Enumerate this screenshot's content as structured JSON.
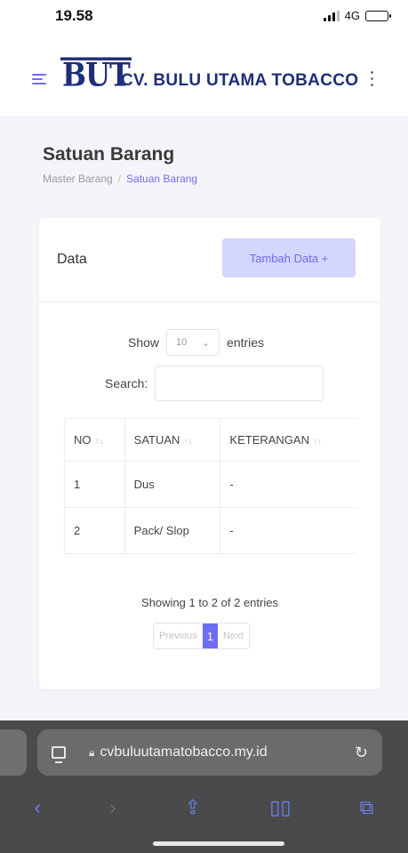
{
  "status_bar": {
    "time": "19.58",
    "network": "4G"
  },
  "header": {
    "logo_text": "BUT",
    "company_name": "CV. BULU UTAMA TOBACCO"
  },
  "page": {
    "title": "Satuan Barang",
    "breadcrumb": {
      "parent": "Master Barang",
      "separator": "/",
      "current": "Satuan Barang"
    }
  },
  "card": {
    "title": "Data",
    "add_button": "Tambah Data +",
    "length_prefix": "Show",
    "length_value": "10",
    "length_suffix": "entries",
    "search_label": "Search:",
    "search_value": "",
    "columns": [
      "NO",
      "SATUAN",
      "KETERANGAN"
    ],
    "sort_glyph": "↑↓",
    "rows": [
      {
        "no": "1",
        "satuan": "Dus",
        "keterangan": "-"
      },
      {
        "no": "2",
        "satuan": "Pack/ Slop",
        "keterangan": "-"
      }
    ],
    "info": "Showing 1 to 2 of 2 entries",
    "pagination": {
      "previous": "Previous",
      "current": "1",
      "next": "Next"
    }
  },
  "browser": {
    "url": "cvbuluutamatobacco.my.id"
  },
  "colors": {
    "accent": "#6f6cf5",
    "brand": "#1f2e7a",
    "button_bg": "#d4d6fb",
    "browser_bg": "#4a4a4c"
  }
}
